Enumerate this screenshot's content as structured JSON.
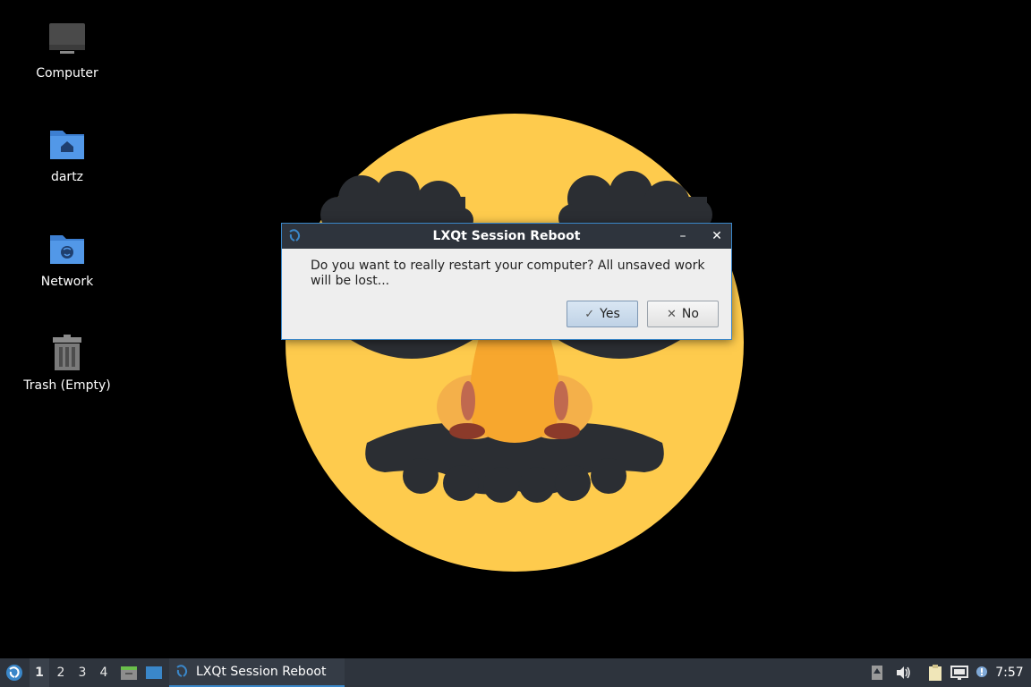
{
  "desktop": {
    "icons": [
      {
        "label": "Computer",
        "icon": "computer-icon"
      },
      {
        "label": "dartz",
        "icon": "home-folder-icon"
      },
      {
        "label": "Network",
        "icon": "network-folder-icon"
      },
      {
        "label": "Trash (Empty)",
        "icon": "trash-icon"
      }
    ],
    "wallpaper": "groucho-glasses-emoji"
  },
  "dialog": {
    "title": "LXQt Session Reboot",
    "message": "Do you want to really restart your computer? All unsaved work will be lost...",
    "yes_label": "Yes",
    "no_label": "No",
    "minimize_glyph": "–",
    "close_glyph": "✕"
  },
  "taskbar": {
    "workspaces": [
      "1",
      "2",
      "3",
      "4"
    ],
    "active_workspace": "1",
    "task_label": "LXQt Session Reboot",
    "clock": "7:57"
  },
  "colors": {
    "accent": "#3a87c9",
    "panel": "#2e343d",
    "dialog_bg": "#eeeeee",
    "emoji_yellow": "#fecb4d"
  }
}
